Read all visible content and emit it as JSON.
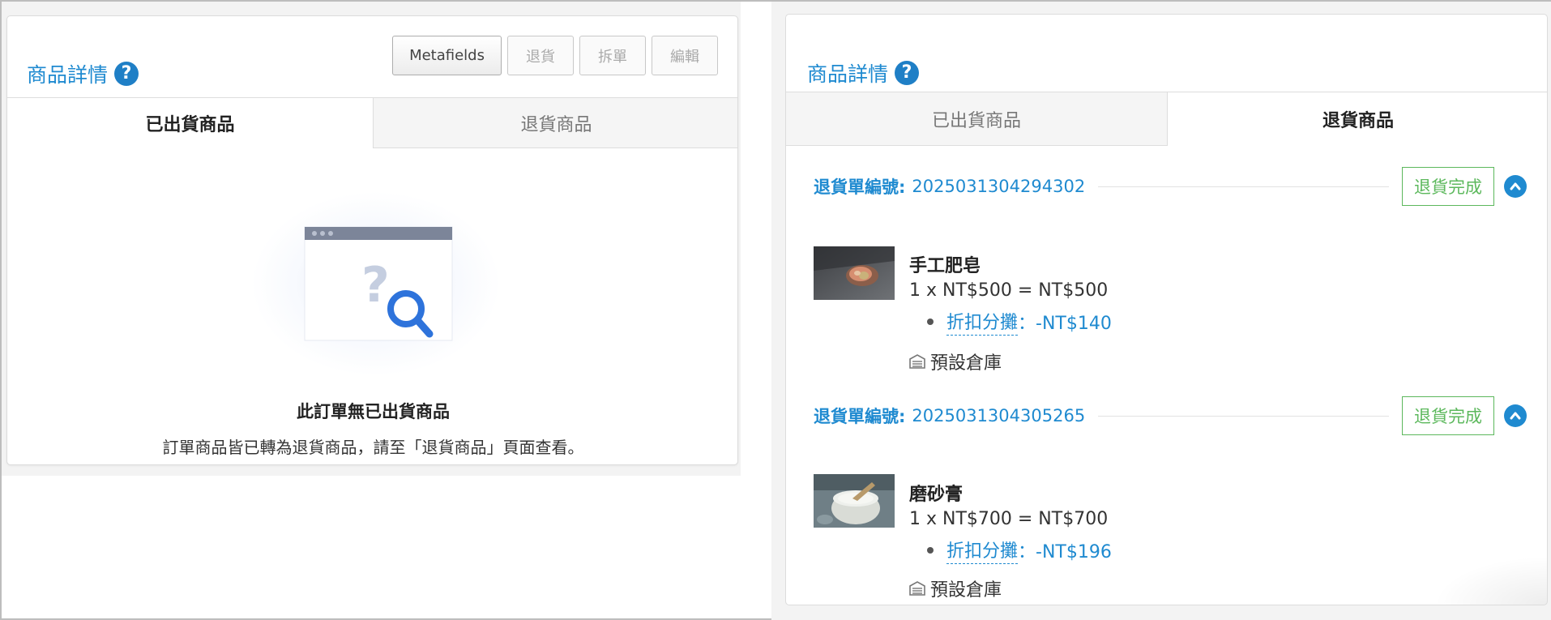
{
  "left_panel": {
    "title": "商品詳情",
    "toolbar": {
      "metafields_label": "Metafields",
      "return_label": "退貨",
      "split_label": "拆單",
      "edit_label": "編輯"
    },
    "tabs": [
      {
        "label": "已出貨商品",
        "active": true
      },
      {
        "label": "退貨商品",
        "active": false
      }
    ],
    "empty_state": {
      "title": "此訂單無已出貨商品",
      "description": "訂單商品皆已轉為退貨商品，請至「退貨商品」頁面查看。"
    }
  },
  "right_panel": {
    "title": "商品詳情",
    "tabs": [
      {
        "label": "已出貨商品",
        "active": false
      },
      {
        "label": "退貨商品",
        "active": true
      }
    ],
    "returns": [
      {
        "label": "退貨單編號:",
        "number": "2025031304294302",
        "status": "退貨完成",
        "item": {
          "name": "手工肥皂",
          "price_line": "1 x NT$500 = NT$500",
          "discount_label": "折扣分攤",
          "discount_value": "：-NT$140",
          "warehouse": "預設倉庫"
        }
      },
      {
        "label": "退貨單編號:",
        "number": "2025031304305265",
        "status": "退貨完成",
        "item": {
          "name": "磨砂膏",
          "price_line": "1 x NT$700 = NT$700",
          "discount_label": "折扣分攤",
          "discount_value": "：-NT$196",
          "warehouse": "預設倉庫"
        }
      }
    ]
  },
  "colors": {
    "accent": "#1f8ad0",
    "success": "#5cb85c",
    "help_icon": "#1f7fc6"
  },
  "icons": [
    "help-icon",
    "empty-search-illustration",
    "chevron-up-icon",
    "warehouse-icon"
  ]
}
